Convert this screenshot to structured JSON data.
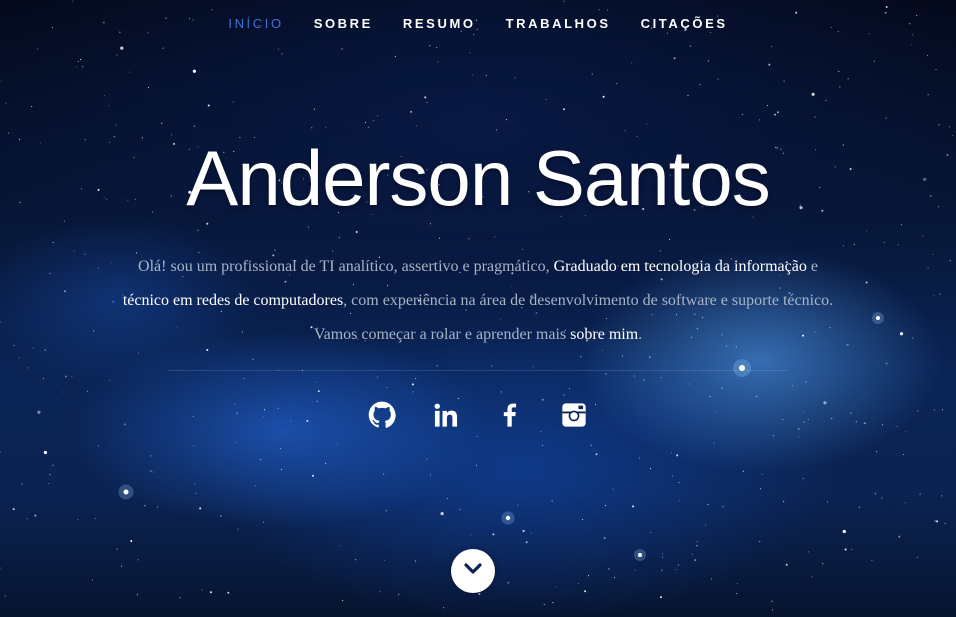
{
  "nav": {
    "items": [
      {
        "label": "Início",
        "active": true
      },
      {
        "label": "Sobre",
        "active": false
      },
      {
        "label": "Resumo",
        "active": false
      },
      {
        "label": "Trabalhos",
        "active": false
      },
      {
        "label": "Citações",
        "active": false
      }
    ]
  },
  "banner": {
    "name": "Anderson Santos",
    "intro": {
      "part1": "Olá! sou um profissional de TI analítico, assertivo e pragmático, ",
      "highlight1": "Graduado em tecnologia da informação",
      "part2": " e ",
      "highlight2": "técnico em redes de computadores",
      "part3": ", com experiência na área de desenvolvimento de software e suporte técnico. Vamos começar a rolar e aprender mais ",
      "link": "sobre mim",
      "part4": "."
    }
  },
  "social": [
    {
      "icon": "github-icon"
    },
    {
      "icon": "linkedin-icon"
    },
    {
      "icon": "facebook-icon"
    },
    {
      "icon": "instagram-icon"
    }
  ],
  "scroll": {
    "icon": "chevron-down-icon"
  },
  "colors": {
    "nav_active": "#3b74d4",
    "text_muted": "#a7b4c6",
    "text_highlight": "#ffffff"
  }
}
